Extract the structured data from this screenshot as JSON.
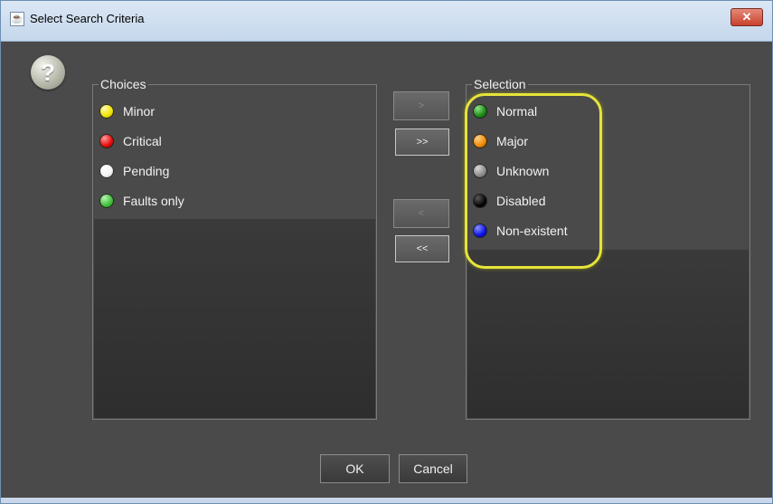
{
  "window": {
    "title": "Select Search Criteria",
    "close_label": "✕"
  },
  "help": {
    "label": "?"
  },
  "choices": {
    "title": "Choices",
    "items": [
      {
        "label": "Minor",
        "color": "#f2e400"
      },
      {
        "label": "Critical",
        "color": "#e80a0a"
      },
      {
        "label": "Pending",
        "color": "#f4f4f4"
      },
      {
        "label": "Faults only",
        "color": "#3fbf3a"
      }
    ]
  },
  "selection": {
    "title": "Selection",
    "items": [
      {
        "label": "Normal",
        "color": "#1a8a14"
      },
      {
        "label": "Major",
        "color": "#f08a00"
      },
      {
        "label": "Unknown",
        "color": "#8a8a8a"
      },
      {
        "label": "Disabled",
        "color": "#050505"
      },
      {
        "label": "Non-existent",
        "color": "#0a12e6"
      }
    ]
  },
  "transfer": {
    "add_one": ">",
    "add_all": ">>",
    "remove_one": "<",
    "remove_all": "<<"
  },
  "footer": {
    "ok_label": "OK",
    "cancel_label": "Cancel"
  }
}
